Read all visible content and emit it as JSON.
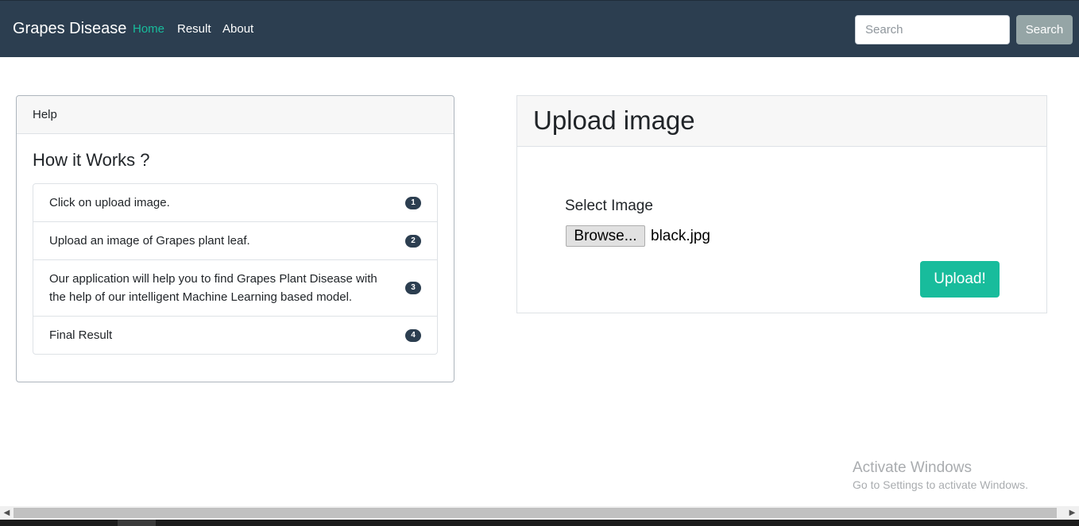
{
  "navbar": {
    "brand": "Grapes Disease",
    "links": [
      {
        "label": "Home",
        "active": true
      },
      {
        "label": "Result",
        "active": false
      },
      {
        "label": "About",
        "active": false
      }
    ],
    "search_placeholder": "Search",
    "search_button": "Search"
  },
  "help": {
    "header": "Help",
    "title": "How it Works ?",
    "steps": [
      {
        "text": "Click on upload image.",
        "badge": "1"
      },
      {
        "text": "Upload an image of Grapes plant leaf.",
        "badge": "2"
      },
      {
        "text": "Our application will help you to find Grapes Plant Disease with the help of our intelligent Machine Learning based model.",
        "badge": "3"
      },
      {
        "text": "Final Result",
        "badge": "4"
      }
    ]
  },
  "upload": {
    "header": "Upload image",
    "select_label": "Select Image",
    "browse_button": "Browse...",
    "file_name": "black.jpg",
    "upload_button": "Upload!"
  },
  "watermark": {
    "title": "Activate Windows",
    "subtitle": "Go to Settings to activate Windows."
  },
  "colors": {
    "navbar": "#2c3e50",
    "accent": "#18bc9c",
    "secondary": "#95a5a6"
  },
  "icons": {
    "scroll_left": "chevron-left-icon",
    "scroll_right": "chevron-right-icon"
  }
}
